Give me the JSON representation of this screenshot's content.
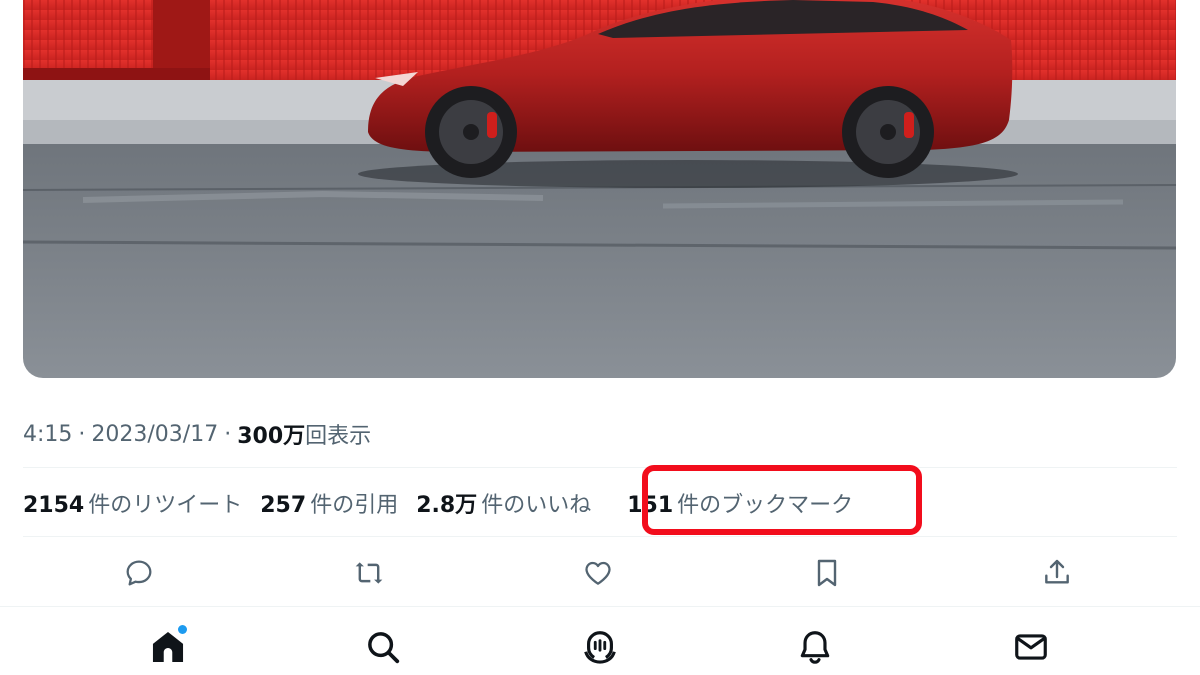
{
  "tweet": {
    "time": "4:15",
    "date": "2023/03/17",
    "views_count": "300万",
    "views_label": "回表示"
  },
  "stats": [
    {
      "count": "2154",
      "label": "件のリツイート"
    },
    {
      "count": "257",
      "label": "件の引用"
    },
    {
      "count": "2.8万",
      "label": "件のいいね"
    },
    {
      "count": "151",
      "label": "件のブックマーク"
    }
  ],
  "actions": [
    "reply-icon",
    "retweet-icon",
    "like-icon",
    "bookmark-icon",
    "share-icon"
  ],
  "nav": [
    "home-icon",
    "search-icon",
    "spaces-icon",
    "notifications-icon",
    "messages-icon"
  ],
  "colors": {
    "highlight": "#f20d1c",
    "notification_dot": "#1d9bf0",
    "muted_text": "#536471"
  }
}
